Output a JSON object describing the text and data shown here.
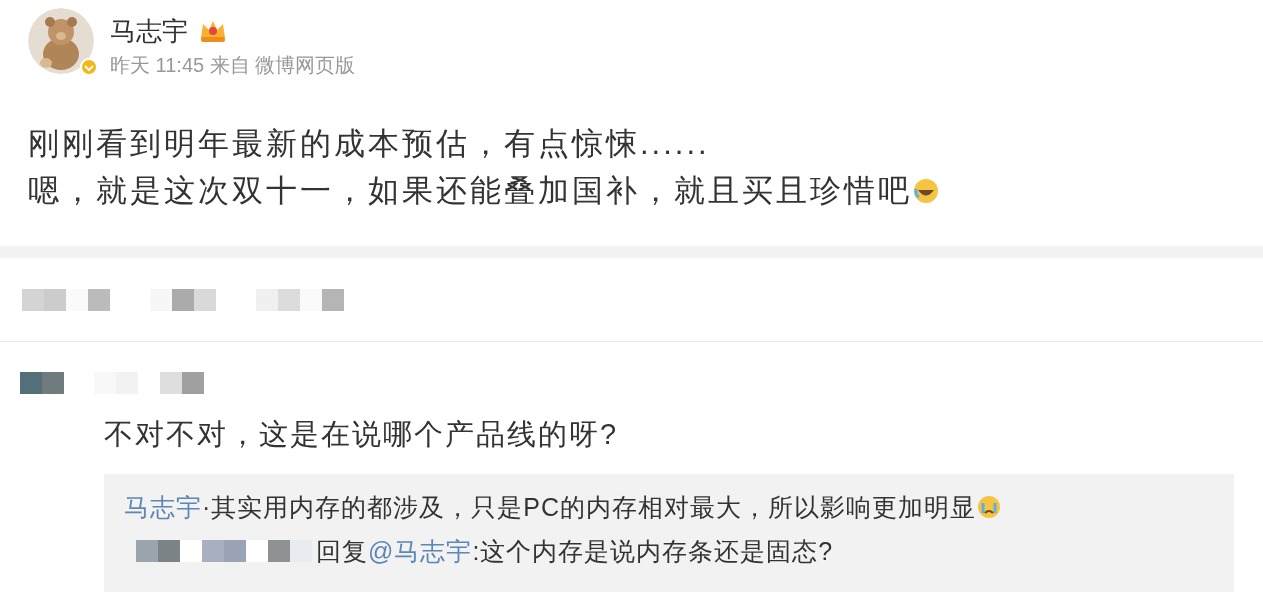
{
  "post": {
    "author": "马志宇",
    "meta": "昨天 11:45 来自 微博网页版",
    "lines": [
      "刚刚看到明年最新的成本预估，有点惊悚......",
      "嗯，就是这次双十一，如果还能叠加国补，就且买且珍惜吧"
    ]
  },
  "comment": {
    "text": "不对不对，这是在说哪个产品线的呀?",
    "replies": [
      {
        "kind": "author",
        "author": "马志宇",
        "text": "·其实用内存的都涉及，只是PC的内存相对最大，所以影响更加明显"
      },
      {
        "kind": "redacted",
        "reply_label": "回复",
        "mention": "@马志宇",
        "text": ":这个内存是说内存条还是固态?"
      }
    ]
  }
}
